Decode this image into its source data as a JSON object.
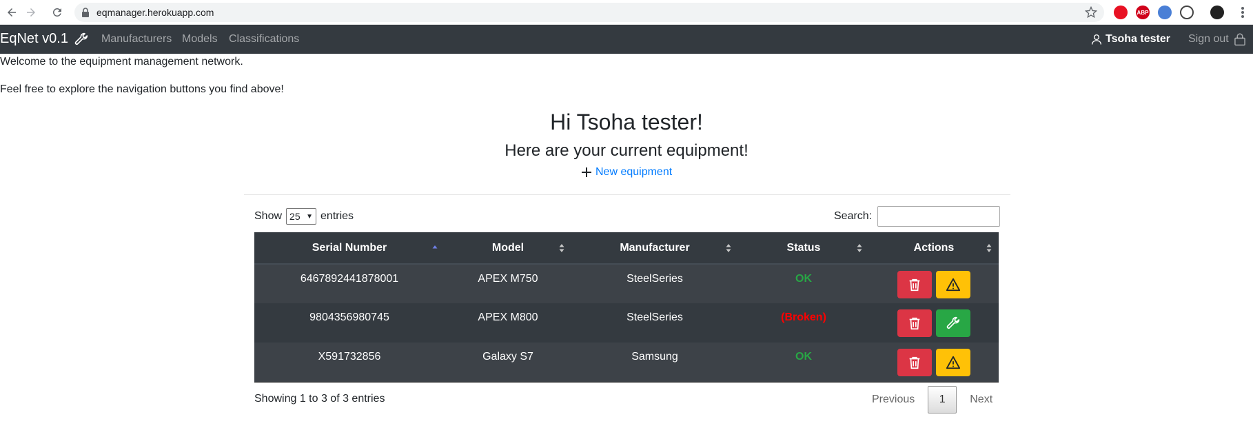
{
  "browser": {
    "url": "eqmanager.herokuapp.com",
    "extensions": [
      {
        "name": "opera-icon",
        "color": "#e81123",
        "text": ""
      },
      {
        "name": "abp-icon",
        "color": "#d0021b",
        "text": "ABP"
      },
      {
        "name": "extension-blue-icon",
        "color": "#4a7fd6",
        "text": ""
      },
      {
        "name": "extension-sync-icon",
        "color": "#444444",
        "text": ""
      },
      {
        "name": "profile-avatar-icon",
        "color": "#222222",
        "text": ""
      }
    ]
  },
  "navbar": {
    "brand": "EqNet v0.1",
    "links": [
      "Manufacturers",
      "Models",
      "Classifications"
    ],
    "user": "Tsoha tester",
    "signout": "Sign out"
  },
  "intro": {
    "welcome": "Welcome to the equipment management network.",
    "explore": "Feel free to explore the navigation buttons you find above!"
  },
  "main": {
    "greeting": "Hi Tsoha tester!",
    "subtitle": "Here are your current equipment!",
    "new_equipment": "New equipment"
  },
  "table_controls": {
    "show_label": "Show",
    "entries_value": "25",
    "entries_label": "entries",
    "search_label": "Search:",
    "search_value": ""
  },
  "table": {
    "headers": [
      "Serial Number",
      "Model",
      "Manufacturer",
      "Status",
      "Actions"
    ],
    "rows": [
      {
        "serial": "6467892441878001",
        "model": "APEX M750",
        "manufacturer": "SteelSeries",
        "status": "OK",
        "status_type": "ok",
        "secondary_action": "warning"
      },
      {
        "serial": "9804356980745",
        "model": "APEX M800",
        "manufacturer": "SteelSeries",
        "status": "(Broken)",
        "status_type": "broken",
        "secondary_action": "repair"
      },
      {
        "serial": "X591732856",
        "model": "Galaxy S7",
        "manufacturer": "Samsung",
        "status": "OK",
        "status_type": "ok",
        "secondary_action": "warning"
      }
    ]
  },
  "footer": {
    "info": "Showing 1 to 3 of 3 entries",
    "previous": "Previous",
    "current_page": "1",
    "next": "Next"
  },
  "colors": {
    "navbar_bg": "#343a40",
    "link": "#007bff",
    "danger": "#dc3545",
    "warning": "#ffc107",
    "success": "#28a745",
    "status_ok": "#28a745",
    "status_broken": "#ff0000"
  }
}
